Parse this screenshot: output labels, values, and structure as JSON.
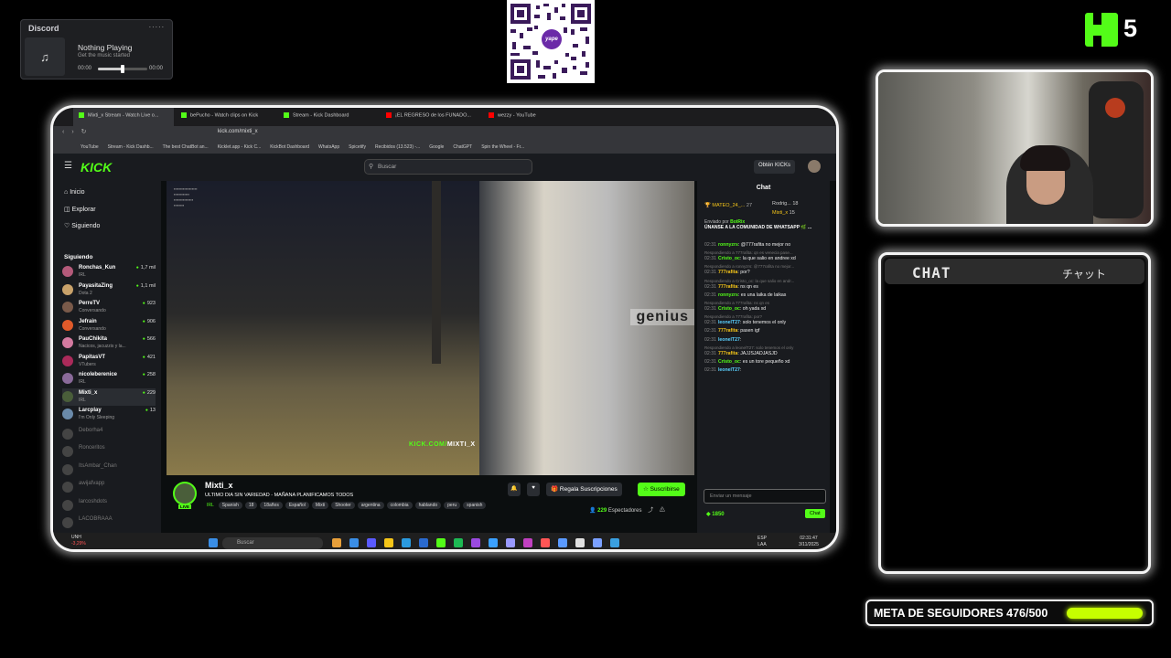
{
  "discord": {
    "title": "Discord",
    "menu": "∙∙∙∙∙",
    "status": "Nothing Playing",
    "subtitle": "Get the music started",
    "time_start": "00:00",
    "time_end": "00:00",
    "progress": 0.5
  },
  "qr": {
    "label": "yape"
  },
  "kick_badge": {
    "number": "5"
  },
  "browser": {
    "tabs": [
      "Mixti_x Stream - Watch Live o...",
      "bePucho - Watch clips on Kick",
      "Stream - Kick Dashboard",
      "¡EL REGRESO de los FUNADO...",
      "wezzy - YouTube"
    ],
    "url": "kick.com/mixti_x",
    "bookmarks": [
      "YouTube",
      "Stream - Kick Dashb...",
      "The best ChatBot an...",
      "Kicklet.app - Kick C...",
      "KickBot Dashboard",
      "WhatsApp",
      "Spicetify",
      "Recibidos (13.523) -...",
      "Google",
      "ChatGPT",
      "Spin the Wheel - Fr..."
    ]
  },
  "kick": {
    "logo": "KICK",
    "search_placeholder": "Buscar",
    "get_kicks": "Obtén KICKs",
    "nav": [
      "Inicio",
      "Explorar",
      "Siguiendo"
    ],
    "following_header": "Siguiendo",
    "channels": [
      {
        "name": "Ronchas_Kun",
        "game": "IRL",
        "viewers": "1,7 mil"
      },
      {
        "name": "PayasitaZing",
        "game": "Dota 2",
        "viewers": "1,1 mil"
      },
      {
        "name": "PerreTV",
        "game": "Conversando",
        "viewers": "923"
      },
      {
        "name": "Jefrain",
        "game": "Conversando",
        "viewers": "906"
      },
      {
        "name": "PauChikita",
        "game": "Nacicos, jacuzzis y la...",
        "viewers": "566"
      },
      {
        "name": "PapitasVT",
        "game": "VTubers",
        "viewers": "421"
      },
      {
        "name": "nicoleberenice",
        "game": "IRL",
        "viewers": "258"
      },
      {
        "name": "Mixti_x",
        "game": "IRL",
        "viewers": "229"
      },
      {
        "name": "Larcplay",
        "game": "I'm Only Sleeping",
        "viewers": "13"
      }
    ],
    "offline_channels": [
      "Deborha4",
      "Ronceritos",
      "ItsAmbar_Chan",
      "awijafvapp",
      "Iarcoshdots",
      "LACOBRAAA"
    ],
    "stream": {
      "watermark_prefix": "KICK.COM/",
      "watermark_user": "MIXTI_X",
      "storefront_sign": "genius",
      "streamer": "Mixti_x",
      "title": "ULTIMO DIA SIN VARIEDAD - MAÑANA PLANIFICAMOS TODOS",
      "category": "IRL",
      "tags": [
        "Spanish",
        "18",
        "18años",
        "Español",
        "Mixti",
        "Shooter",
        "argentina",
        "colombia",
        "hablando",
        "peru",
        "spanish"
      ],
      "live_label": "LIVE",
      "gift_label": "Regala Suscripciones",
      "subscribe_label": "Suscribirse",
      "viewers": "229",
      "viewers_label": "Espectadores"
    },
    "chat": {
      "title": "Chat",
      "leaders": [
        {
          "name": "MATEO_24_...",
          "count": "27"
        },
        {
          "name": "Rodrig...",
          "count": "18"
        },
        {
          "name": "Mixti_x",
          "count": "15"
        }
      ],
      "pinned_by": "Enviado por",
      "pinned_user": "BotRix",
      "pinned_text": "ÚNANSE A LA COMUNIDAD DE WHATSAPP 🌿 ...",
      "messages": [
        {
          "time": "02:31",
          "user": "ronnyzrs",
          "text": ": @777rafita no mejor no",
          "color": "#53fc18",
          "reply": ""
        },
        {
          "time": "02:31",
          "user": "Cristo_oc",
          "text": ": la que salio en andree xd",
          "color": "#53fc18",
          "reply": "Respondiendo a 777rafita: qn es venecia pase..."
        },
        {
          "time": "02:31",
          "user": "777rafita",
          "text": ": por?",
          "color": "#f5c518",
          "reply": "Respondiendo a ronnyzrs: @777rafita no mejor..."
        },
        {
          "time": "02:31",
          "user": "777rafita",
          "text": ": ns qn es",
          "color": "#f5c518",
          "reply": "Respondiendo a Cristo_oc: la que salio en andr..."
        },
        {
          "time": "02:31",
          "user": "ronnyzrs",
          "text": ": es una laika de laikas",
          "color": "#53fc18",
          "reply": ""
        },
        {
          "time": "02:31",
          "user": "Cristo_oc",
          "text": ": oh yada xd",
          "color": "#53fc18",
          "reply": "Respondiendo a 777rafita: ns qn es"
        },
        {
          "time": "02:31",
          "user": "leonelT27",
          "text": ": solo tenemos el only",
          "color": "#5ad1ff",
          "reply": "Respondiendo a 777rafita: por?"
        },
        {
          "time": "02:31",
          "user": "777rafita",
          "text": ": pasen igf",
          "color": "#f5c518",
          "reply": ""
        },
        {
          "time": "02:31",
          "user": "leonelT27",
          "text": ":",
          "color": "#5ad1ff",
          "reply": ""
        },
        {
          "time": "02:31",
          "user": "777rafita",
          "text": ": JAJJSJADJASJD",
          "color": "#f5c518",
          "reply": "Respondiendo a leonelT27: solo tenemos el only"
        },
        {
          "time": "02:31",
          "user": "Cristo_oc",
          "text": ": es un tore pequeño xd",
          "color": "#53fc18",
          "reply": ""
        },
        {
          "time": "02:31",
          "user": "leonelT27",
          "text": ":",
          "color": "#5ad1ff",
          "reply": ""
        }
      ],
      "input_placeholder": "Enviar un mensaje",
      "kicks": "1850",
      "send_label": "Chat"
    }
  },
  "taskbar": {
    "ticker": "UNH",
    "ticker_change": "-3,29%",
    "search_placeholder": "Buscar",
    "lang": "ESP",
    "region": "LAA",
    "time": "02:31:47",
    "date": "3/11/2025"
  },
  "overlay_chat": {
    "title": "CHAT",
    "title_jp": "チャット"
  },
  "goal": {
    "label": "META DE SEGUIDORES 476/500",
    "current": 476,
    "target": 500,
    "color": "#c6ff00"
  }
}
